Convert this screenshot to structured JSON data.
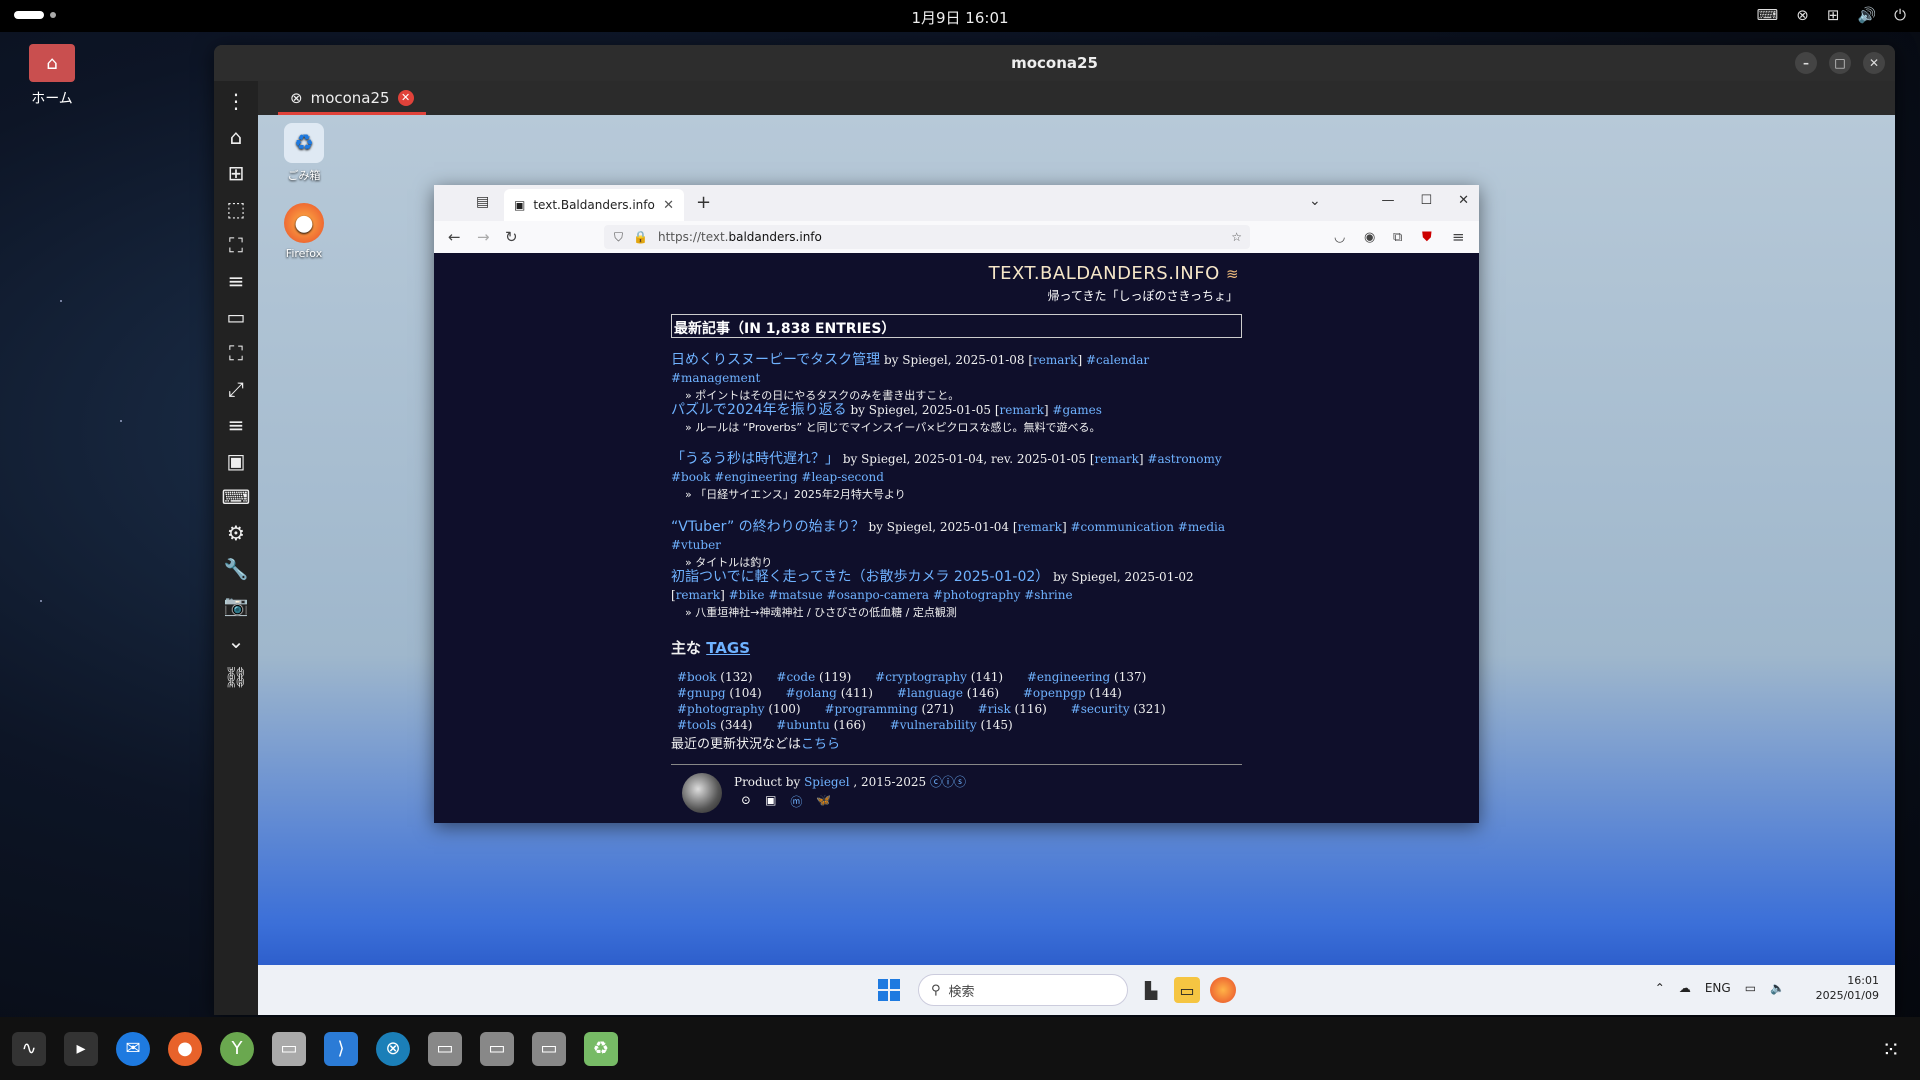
{
  "topbar": {
    "clock": "1月9日  16:01"
  },
  "desktop": {
    "home_label": "ホーム"
  },
  "remote": {
    "window_title": "mocona25",
    "tab_label": "mocona25",
    "toolbar_icons": [
      "more-vert-icon",
      "home-icon",
      "add-window-icon",
      "fit-icon",
      "fullscreen-icon",
      "menu-icon",
      "screen-icon",
      "scale-icon",
      "expand-icon",
      "menu2-icon",
      "display-icon",
      "keyboard-icon",
      "settings-icon",
      "tools-icon",
      "camera-icon",
      "chevron-down-icon",
      "disconnect-icon"
    ]
  },
  "win_desktop": {
    "icons": [
      {
        "label": "ごみ箱",
        "glyph": "♻"
      },
      {
        "label": "Firefox",
        "glyph": "🦊"
      }
    ],
    "taskbar": {
      "search_placeholder": "検索",
      "lang": "ENG",
      "time": "16:01",
      "date": "2025/01/09"
    }
  },
  "firefox": {
    "tab_title": "text.Baldanders.info",
    "url_scheme": "https://text.",
    "url_host": "baldanders.info",
    "site_title": "TEXT.BALDANDERS.INFO",
    "site_subtitle": "帰ってきた「しっぽのさきっちょ」",
    "section_heading": "最新記事（IN 1,838 ENTRIES）",
    "entries": [
      {
        "title": "日めくりスヌーピーでタスク管理",
        "meta": " by Spiegel, 2025-01-08 [",
        "remark": "remark",
        "after": "] ",
        "tags": "#calendar #management",
        "desc": "» ポイントはその日にやるタスクのみを書き出すこと。"
      },
      {
        "title": "パズルで2024年を振り返る",
        "meta": " by Spiegel, 2025-01-05 [",
        "remark": "remark",
        "after": "] ",
        "tags": "#games",
        "desc": "» ルールは “Proverbs” と同じでマインスイーパ×ピクロスな感じ。無料で遊べる。"
      },
      {
        "title": "「うるう秒は時代遅れ？」",
        "meta": " by Spiegel, 2025-01-04, rev. 2025-01-05 [",
        "remark": "remark",
        "after": "] ",
        "tags": "#astronomy #book #engineering #leap-second",
        "desc": "» 「日経サイエンス」2025年2月特大号より"
      },
      {
        "title": "“VTuber” の終わりの始まり？",
        "meta": " by Spiegel, 2025-01-04 [",
        "remark": "remark",
        "after": "] ",
        "tags": "#communication #media #vtuber",
        "desc": "» タイトルは釣り"
      },
      {
        "title": "初詣ついでに軽く走ってきた（お散歩カメラ 2025-01-02）",
        "meta": " by Spiegel, 2025-01-02 [",
        "remark": "remark",
        "after": "] ",
        "tags": "#bike #matsue #osanpo-camera #photography #shrine",
        "desc": "» 八重垣神社→神魂神社 / ひさびさの低血糖 / 定点観測"
      }
    ],
    "tags_heading_prefix": "主な ",
    "tags_heading_link": "TAGS",
    "tags": [
      {
        "name": "#book",
        "count": "(132)"
      },
      {
        "name": "#code",
        "count": "(119)"
      },
      {
        "name": "#cryptography",
        "count": "(141)"
      },
      {
        "name": "#engineering",
        "count": "(137)"
      },
      {
        "name": "#gnupg",
        "count": "(104)"
      },
      {
        "name": "#golang",
        "count": "(411)"
      },
      {
        "name": "#language",
        "count": "(146)"
      },
      {
        "name": "#openpgp",
        "count": "(144)"
      },
      {
        "name": "#photography",
        "count": "(100)"
      },
      {
        "name": "#programming",
        "count": "(271)"
      },
      {
        "name": "#risk",
        "count": "(116)"
      },
      {
        "name": "#security",
        "count": "(321)"
      },
      {
        "name": "#tools",
        "count": "(344)"
      },
      {
        "name": "#ubuntu",
        "count": "(166)"
      },
      {
        "name": "#vulnerability",
        "count": "(145)"
      }
    ],
    "recent_text": "最近の更新状況などは",
    "recent_link": "こちら",
    "footer_prefix": "Product by ",
    "footer_author": "Spiegel",
    "footer_years": " , 2015-2025 ",
    "footer_cc": "ⓒⓘⓢ",
    "social_icons": [
      "github-icon",
      "chat-icon",
      "mastodon-icon",
      "bluesky-icon"
    ]
  },
  "colors": {
    "link": "#6fb2ff",
    "title": "#f5e6c8",
    "page_bg": "#0f0f2b",
    "accent": "#e0423a"
  }
}
